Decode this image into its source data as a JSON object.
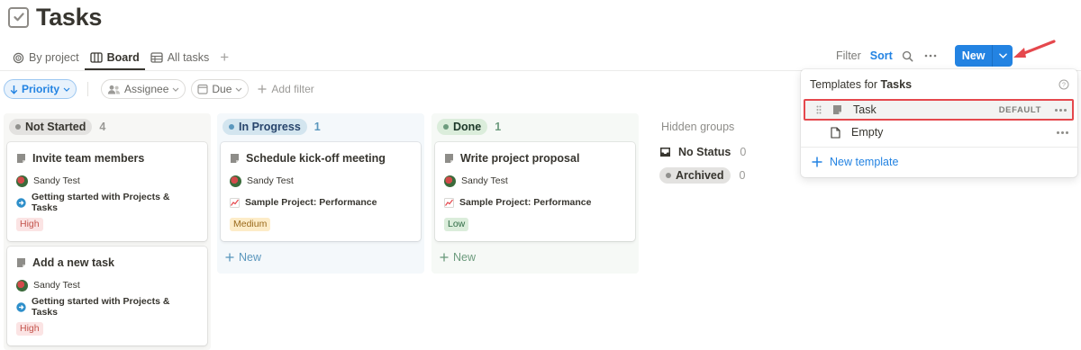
{
  "page": {
    "title": "Tasks"
  },
  "views": {
    "by_project": "By project",
    "board": "Board",
    "all_tasks": "All tasks",
    "add": "+"
  },
  "toolbar": {
    "filter": "Filter",
    "sort": "Sort",
    "new": "New"
  },
  "filters": {
    "priority": "Priority",
    "assignee": "Assignee",
    "due": "Due",
    "add_filter": "Add filter"
  },
  "board": {
    "columns": [
      {
        "status": "Not Started",
        "count": "4",
        "cards": [
          {
            "title": "Invite team members",
            "assignee": "Sandy Test",
            "project": "Getting started with Projects & Tasks",
            "priority": "High"
          },
          {
            "title": "Add a new task",
            "assignee": "Sandy Test",
            "project": "Getting started with Projects & Tasks",
            "priority": "High"
          }
        ]
      },
      {
        "status": "In Progress",
        "count": "1",
        "new_label": "New",
        "cards": [
          {
            "title": "Schedule kick-off meeting",
            "assignee": "Sandy Test",
            "project": "Sample Project: Performance",
            "priority": "Medium"
          }
        ]
      },
      {
        "status": "Done",
        "count": "1",
        "new_label": "New",
        "cards": [
          {
            "title": "Write project proposal",
            "assignee": "Sandy Test",
            "project": "Sample Project: Performance",
            "priority": "Low"
          }
        ]
      }
    ],
    "hidden_groups": {
      "title": "Hidden groups",
      "items": [
        {
          "label": "No Status",
          "count": "0"
        },
        {
          "label": "Archived",
          "count": "0"
        }
      ]
    }
  },
  "templates_menu": {
    "title_prefix": "Templates for",
    "title_db": "Tasks",
    "items": [
      {
        "label": "Task",
        "badge": "DEFAULT"
      },
      {
        "label": "Empty"
      }
    ],
    "new_template": "New template"
  },
  "colors": {
    "accent": "#2383e2",
    "high_bg": "#fbe4e4",
    "high_fg": "#c4554d",
    "medium_bg": "#fdecc8",
    "medium_fg": "#9a6a1c",
    "low_bg": "#dbeddb",
    "low_fg": "#2f6b45",
    "inprogress_col": "#f4f8fb",
    "done_col": "#f6f9f6",
    "notstarted_col": "#f7f7f5"
  }
}
